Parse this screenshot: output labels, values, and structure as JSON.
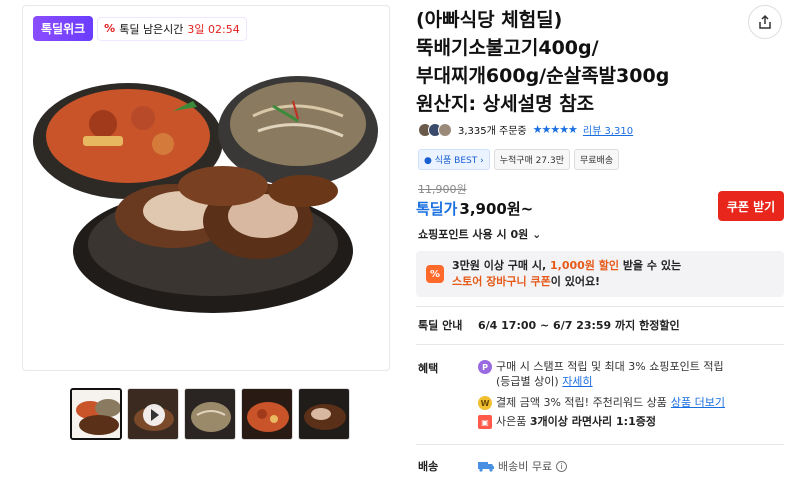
{
  "badge": {
    "brand": "톡딜위크",
    "timer_pct": "%",
    "timer_label": "톡딜 남은시간",
    "timer_value": "3일 02:54"
  },
  "product": {
    "title_lines": [
      "(아빠식당 체험딜)",
      "뚝배기소불고기400g/",
      "부대찌개600g/순살족발300g",
      "원산지: 상세설명 참조"
    ]
  },
  "meta": {
    "orders": "3,335개 주문중",
    "stars": "★★★★★",
    "review_label": "리뷰 3,310"
  },
  "tags": [
    "식품 BEST",
    "누적구매 27.3만",
    "무료배송"
  ],
  "price": {
    "original": "11,900원",
    "label": "톡딜가",
    "value": "3,900원~",
    "coupon_button": "쿠폰 받기",
    "points": "쇼핑포인트 사용 시 0원"
  },
  "promo": {
    "icon": "%",
    "line1_a": "3만원 이상 구매 시, ",
    "line1_b": "1,000원 할인",
    "line1_c": " 받을 수 있는",
    "line2_a": "스토어 장바구니 쿠폰",
    "line2_b": "이 있어요!"
  },
  "deal": {
    "label": "톡딜 안내",
    "period": "6/4 17:00 ~ 6/7 23:59 까지 한정할인"
  },
  "benefits": {
    "label": "혜택",
    "item1_line1": "구매 시 스탬프 적립 및 최대 3% 쇼핑포인트 적립",
    "item1_line2": "(등급별 상이)",
    "item1_link": "자세히",
    "item2_text": "결제 금액 3% 적립! 주천리워드 상품",
    "item2_link": "상품 더보기",
    "item3_a": "사은품 ",
    "item3_b": "3개이상 라면사리 1:1증정"
  },
  "shipping": {
    "label": "배송",
    "value": "배송비 무료"
  },
  "colors": {
    "brand_purple": "#7b4dff",
    "accent_blue": "#1a6fe0",
    "coupon_red": "#e8261c",
    "promo_orange": "#e55a1a"
  }
}
